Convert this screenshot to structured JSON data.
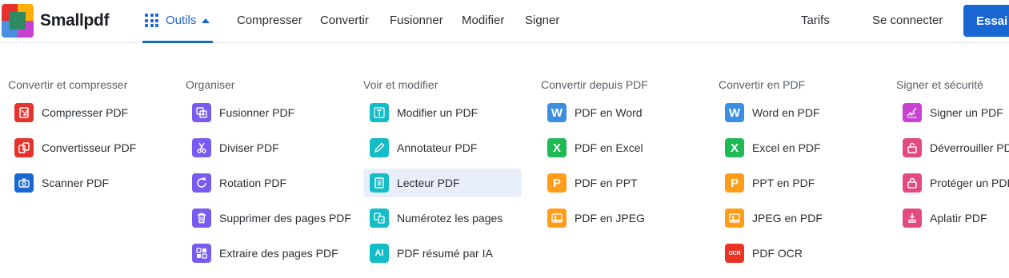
{
  "brand": {
    "name": "Smallpdf"
  },
  "header": {
    "outils_label": "Outils",
    "nav": [
      "Compresser",
      "Convertir",
      "Fusionner",
      "Modifier",
      "Signer"
    ],
    "pricing": "Tarifs",
    "signin": "Se connecter",
    "trial": "Essai"
  },
  "colors": {
    "accent": "#1967d2",
    "red": "#e5322d",
    "purple": "#7a5bf1",
    "teal": "#13bcc7",
    "blue": "#3c8fe0",
    "green": "#1fb955",
    "orange": "#ff9d1a",
    "pink": "#e44a80",
    "magenta": "#c842d1",
    "ocr_red": "#ea3323",
    "active_bg": "#e8effb"
  },
  "menu": {
    "columns": [
      {
        "title": "Convertir et compresser",
        "items": [
          {
            "label": "Compresser PDF",
            "icon": "compress-icon",
            "color": "#e5322d"
          },
          {
            "label": "Convertisseur PDF",
            "icon": "convert-icon",
            "color": "#e5322d"
          },
          {
            "label": "Scanner PDF",
            "icon": "camera-icon",
            "color": "#1967d2"
          }
        ]
      },
      {
        "title": "Organiser",
        "items": [
          {
            "label": "Fusionner PDF",
            "icon": "merge-icon",
            "color": "#7a5bf1"
          },
          {
            "label": "Diviser PDF",
            "icon": "scissors-icon",
            "color": "#7a5bf1"
          },
          {
            "label": "Rotation PDF",
            "icon": "rotate-icon",
            "color": "#7a5bf1"
          },
          {
            "label": "Supprimer des pages PDF",
            "icon": "trash-icon",
            "color": "#7a5bf1"
          },
          {
            "label": "Extraire des pages PDF",
            "icon": "extract-icon",
            "color": "#7a5bf1"
          }
        ]
      },
      {
        "title": "Voir et modifier",
        "items": [
          {
            "label": "Modifier un PDF",
            "icon": "text-edit-icon",
            "color": "#13bcc7"
          },
          {
            "label": "Annotateur PDF",
            "icon": "pencil-icon",
            "color": "#13bcc7"
          },
          {
            "label": "Lecteur PDF",
            "icon": "reader-icon",
            "color": "#13bcc7",
            "active": true
          },
          {
            "label": "Numérotez les pages",
            "icon": "page-numbers-icon",
            "color": "#13bcc7"
          },
          {
            "label": "PDF résumé par IA",
            "icon": "ai-icon",
            "color": "#13bcc7",
            "glyph": "AI"
          }
        ]
      },
      {
        "title": "Convertir depuis PDF",
        "items": [
          {
            "label": "PDF en Word",
            "icon": "word-icon",
            "color": "#3c8fe0",
            "glyph": "W"
          },
          {
            "label": "PDF en Excel",
            "icon": "excel-icon",
            "color": "#1fb955",
            "glyph": "X"
          },
          {
            "label": "PDF en PPT",
            "icon": "ppt-icon",
            "color": "#ff9d1a",
            "glyph": "P"
          },
          {
            "label": "PDF en JPEG",
            "icon": "image-icon",
            "color": "#ff9d1a"
          }
        ]
      },
      {
        "title": "Convertir en PDF",
        "items": [
          {
            "label": "Word en PDF",
            "icon": "word-icon",
            "color": "#3c8fe0",
            "glyph": "W"
          },
          {
            "label": "Excel en PDF",
            "icon": "excel-icon",
            "color": "#1fb955",
            "glyph": "X"
          },
          {
            "label": "PPT en PDF",
            "icon": "ppt-icon",
            "color": "#ff9d1a",
            "glyph": "P"
          },
          {
            "label": "JPEG en PDF",
            "icon": "image-icon",
            "color": "#ff9d1a"
          },
          {
            "label": "PDF OCR",
            "icon": "ocr-icon",
            "color": "#ea3323",
            "glyph": "OCR"
          }
        ]
      },
      {
        "title": "Signer et sécurité",
        "items": [
          {
            "label": "Signer un PDF",
            "icon": "signature-icon",
            "color": "#c842d1"
          },
          {
            "label": "Déverrouiller PDF",
            "icon": "unlock-icon",
            "color": "#e44a80"
          },
          {
            "label": "Protéger un PDF",
            "icon": "lock-icon",
            "color": "#e44a80"
          },
          {
            "label": "Aplatir PDF",
            "icon": "flatten-icon",
            "color": "#e44a80"
          }
        ]
      }
    ]
  }
}
